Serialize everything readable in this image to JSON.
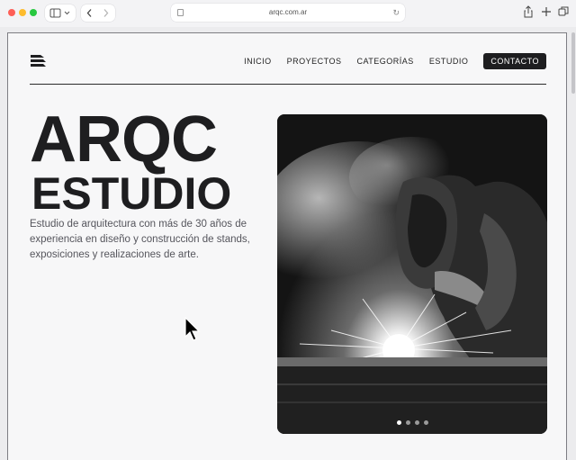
{
  "browser": {
    "url": "arqc.com.ar",
    "icons": [
      "sidebar-icon",
      "chevron-down-icon",
      "back-icon",
      "forward-icon",
      "page-icon",
      "reload-icon",
      "share-icon",
      "new-tab-icon",
      "tabs-overview-icon"
    ]
  },
  "header": {
    "nav": [
      "INICIO",
      "PROYECTOS",
      "CATEGORÍAS",
      "ESTUDIO"
    ],
    "cta": "CONTACTO"
  },
  "hero": {
    "title": "ARQC",
    "subtitle": "ESTUDIO",
    "description": "Estudio de arquitectura con más de 30 años de experiencia en diseño y construcción de stands, exposiciones y realizaciones de arte.",
    "image": "black-and-white photo of a welder with mask and sparks",
    "carousel": {
      "count": 4,
      "active": 1
    }
  },
  "colors": {
    "accent": "#1e1e20",
    "background": "#f7f7f8",
    "text": "#55555c"
  }
}
